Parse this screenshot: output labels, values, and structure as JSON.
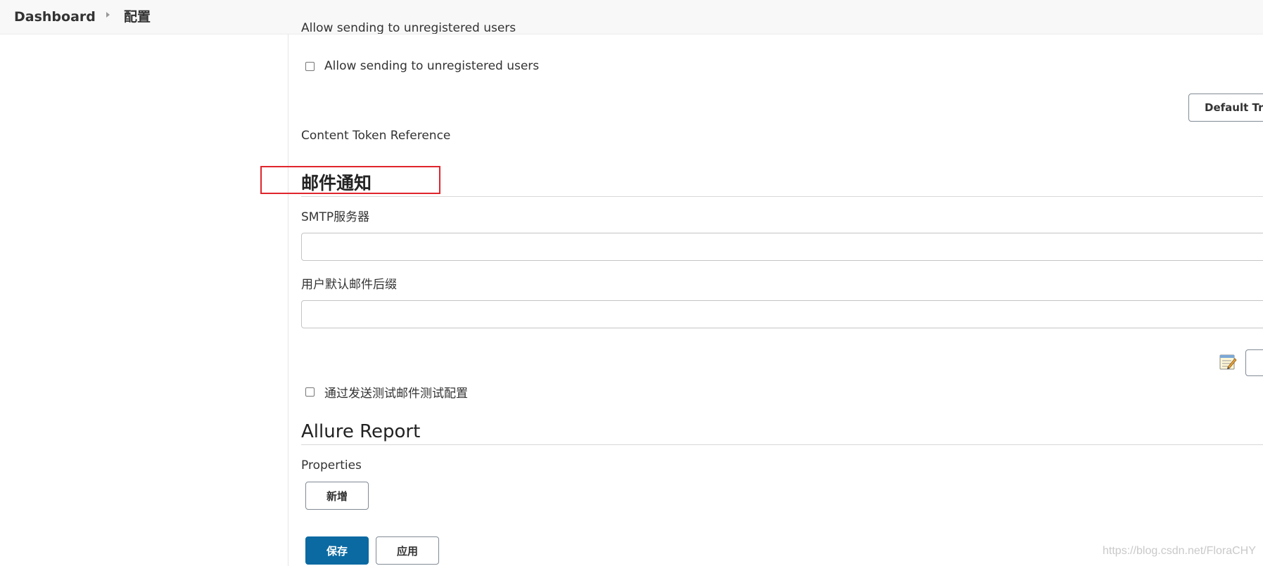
{
  "breadcrumb": {
    "home": "Dashboard",
    "current": "配置"
  },
  "extended_email": {
    "cut_off_text": "Allow sending to unregistered users",
    "allow_unregistered_label": "Allow sending to unregistered users",
    "allow_unregistered_checked": false,
    "default_triggers_button": "Default Triggers",
    "content_token_reference": "Content Token Reference"
  },
  "email_notification": {
    "title": "邮件通知",
    "smtp_label": "SMTP服务器",
    "smtp_value": "",
    "suffix_label": "用户默认邮件后缀",
    "suffix_value": "",
    "test_config_label": "通过发送测试邮件测试配置",
    "test_config_checked": false
  },
  "allure": {
    "title": "Allure Report",
    "properties_label": "Properties",
    "add_button": "新增"
  },
  "actions": {
    "save": "保存",
    "apply": "应用"
  },
  "watermark": "https://blog.csdn.net/FloraCHY",
  "colors": {
    "primary": "#0b6aa2",
    "highlight": "#e0242c",
    "topbar": "#f8f8f8"
  }
}
